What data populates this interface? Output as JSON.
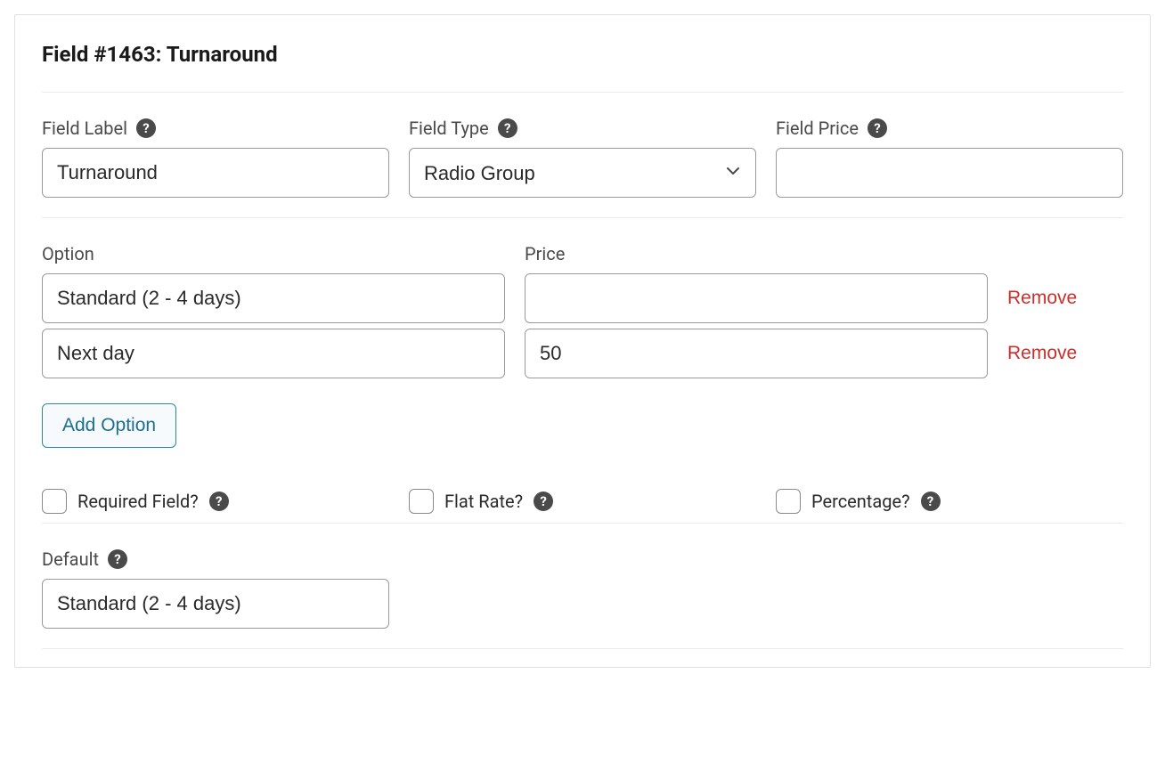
{
  "panel": {
    "title": "Field #1463: Turnaround"
  },
  "fields": {
    "label": {
      "text": "Field Label",
      "value": "Turnaround"
    },
    "type": {
      "text": "Field Type",
      "value": "Radio Group"
    },
    "price": {
      "text": "Field Price",
      "value": ""
    }
  },
  "options": {
    "option_header": "Option",
    "price_header": "Price",
    "rows": [
      {
        "option": "Standard (2 - 4 days)",
        "price": "",
        "remove": "Remove"
      },
      {
        "option": "Next day",
        "price": "50",
        "remove": "Remove"
      }
    ],
    "add_label": "Add Option"
  },
  "checkboxes": {
    "required": {
      "label": "Required Field?",
      "checked": false
    },
    "flat_rate": {
      "label": "Flat Rate?",
      "checked": false
    },
    "percentage": {
      "label": "Percentage?",
      "checked": false
    }
  },
  "default": {
    "label": "Default",
    "value": "Standard (2 - 4 days)"
  },
  "help_glyph": "?"
}
